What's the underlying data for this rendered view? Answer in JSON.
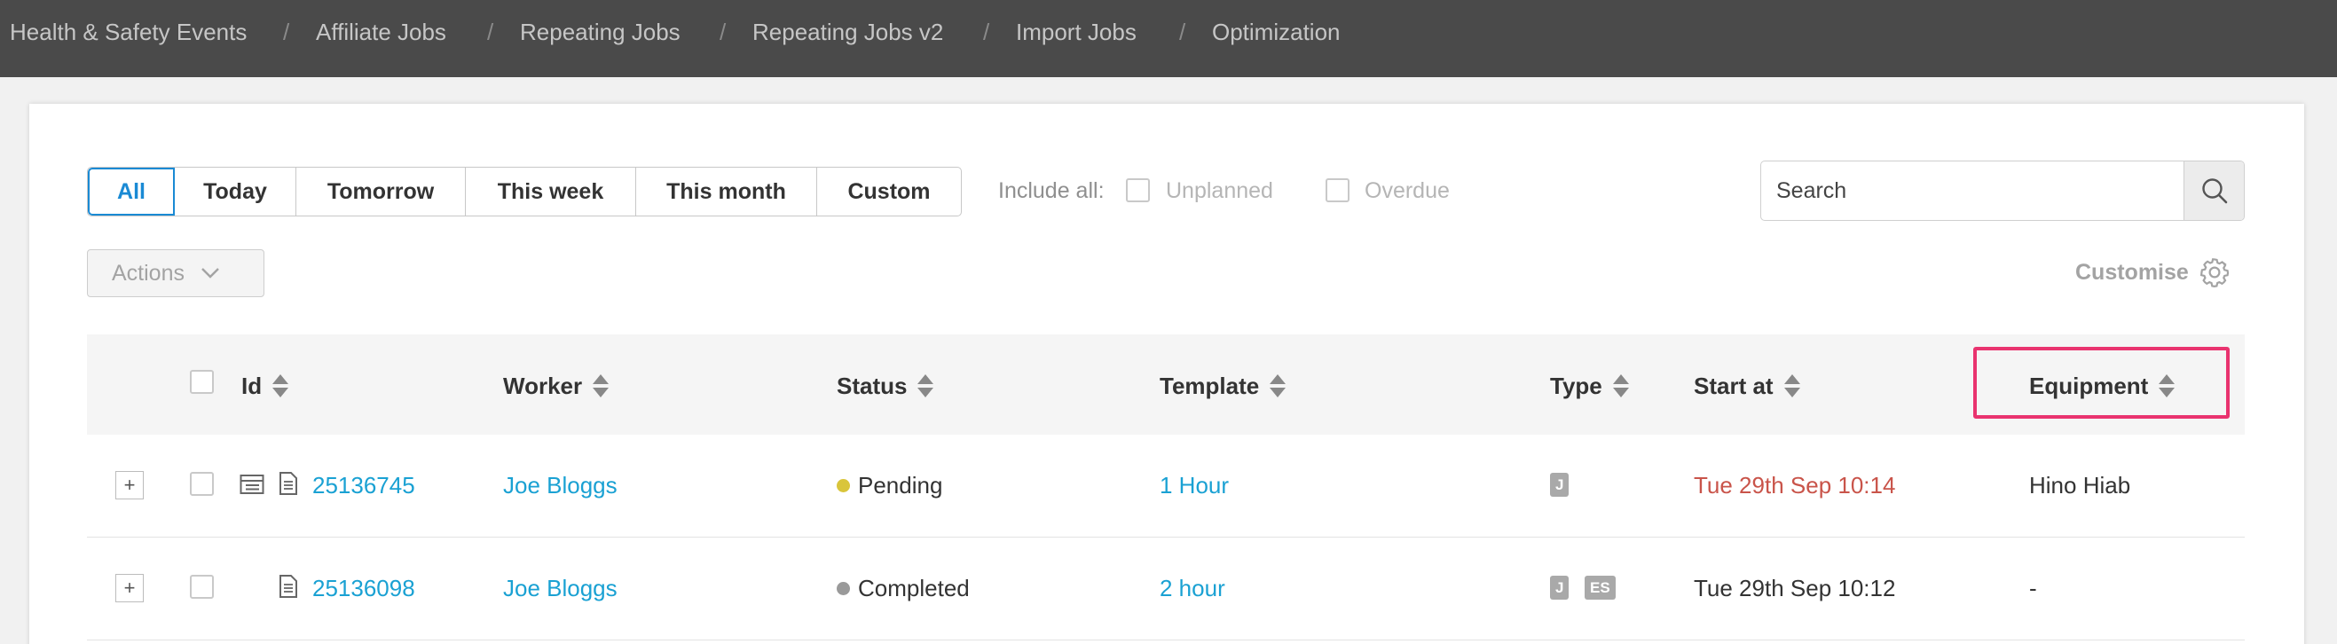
{
  "topnav": {
    "items": [
      "Health & Safety Events",
      "Affiliate Jobs",
      "Repeating Jobs",
      "Repeating Jobs v2",
      "Import Jobs",
      "Optimization"
    ],
    "separator": "/"
  },
  "filters": {
    "tabs": [
      "All",
      "Today",
      "Tomorrow",
      "This week",
      "This month",
      "Custom"
    ],
    "active_tab": "All",
    "include_all_label": "Include all:",
    "unplanned_label": "Unplanned",
    "overdue_label": "Overdue"
  },
  "search": {
    "placeholder": "Search",
    "value": ""
  },
  "toolbar": {
    "actions_label": "Actions",
    "customise_label": "Customise"
  },
  "table": {
    "columns": [
      "Id",
      "Worker",
      "Status",
      "Template",
      "Type",
      "Start at",
      "Equipment"
    ],
    "highlighted_column": "Equipment",
    "rows": [
      {
        "id": "25136745",
        "worker": "Joe Bloggs",
        "status": "Pending",
        "status_color": "#d9c53b",
        "template": "1 Hour",
        "types": [
          "J"
        ],
        "start_at": "Tue 29th Sep 10:14",
        "start_color": "#c9544a",
        "equipment": "Hino Hiab",
        "has_list_icon": true
      },
      {
        "id": "25136098",
        "worker": "Joe Bloggs",
        "status": "Completed",
        "status_color": "#9a9a9a",
        "template": "2 hour",
        "types": [
          "J",
          "ES"
        ],
        "start_at": "Tue 29th Sep 10:12",
        "start_color": "#333333",
        "equipment": "-",
        "has_list_icon": false
      }
    ]
  },
  "colors": {
    "nav_bg": "#4a4a4a",
    "accent": "#1a8ad4",
    "link": "#1aa1d3",
    "highlight": "#e9336f"
  }
}
